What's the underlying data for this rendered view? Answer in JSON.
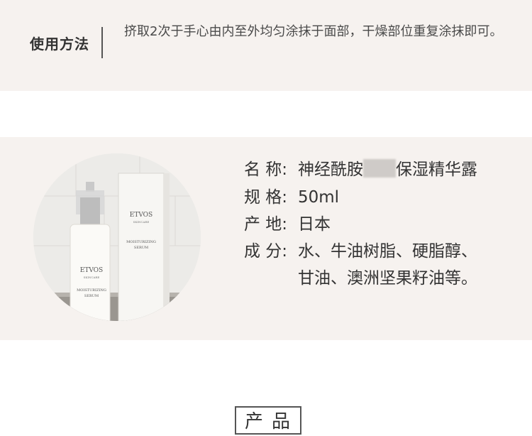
{
  "usage": {
    "label": "使用方法",
    "text": "挤取2次于手心由内至外均匀涂抹于面部，干燥部位重复涂抹即可。"
  },
  "product": {
    "photo": {
      "bottle_brand": "ETVOS",
      "bottle_sub": "SKINCARE",
      "bottle_name_1": "MOISTURIZING",
      "bottle_name_2": "SERUM",
      "box_brand": "ETVOS",
      "box_sub": "SKINCARE",
      "box_name_1": "MOISTURIZING",
      "box_name_2": "SERUM"
    },
    "specs": {
      "name_label": "名 称:",
      "name_value_a": "神经酰胺",
      "name_value_b": "保湿精华露",
      "size_label": "规 格:",
      "size_value": "50ml",
      "origin_label": "产 地:",
      "origin_value": "日本",
      "ingredients_label": "成 分:",
      "ingredients_line1": "水、牛油树脂、硬脂醇、",
      "ingredients_line2": "甘油、澳洲坚果籽油等。"
    }
  },
  "footer": {
    "section_title": "产品"
  },
  "colors": {
    "panel_bg": "#f6f2ef",
    "text": "#333333"
  }
}
